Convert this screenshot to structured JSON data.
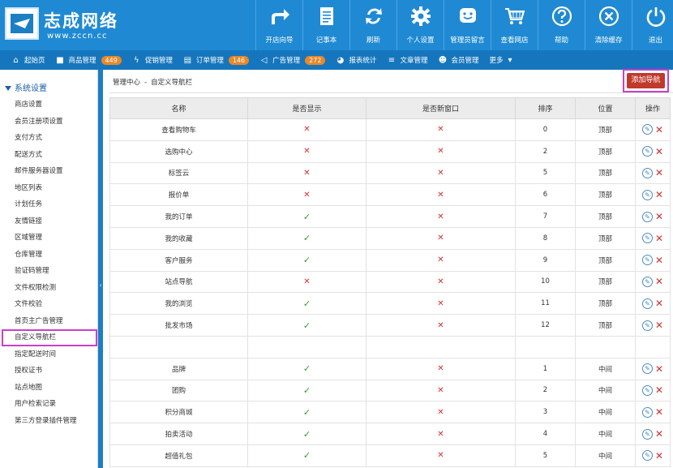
{
  "header": {
    "logo_title": "志成网络",
    "logo_url_text": "www.zccn.cc",
    "tools": [
      {
        "label": "开店向导",
        "icon": "arrow-share-icon"
      },
      {
        "label": "记事本",
        "icon": "notepad-icon"
      },
      {
        "label": "刷新",
        "icon": "refresh-icon"
      },
      {
        "label": "个人设置",
        "icon": "gear-icon"
      },
      {
        "label": "管理员留言",
        "icon": "message-face-icon"
      },
      {
        "label": "查看网店",
        "icon": "cart-icon"
      },
      {
        "label": "帮助",
        "icon": "help-icon"
      },
      {
        "label": "清除缓存",
        "icon": "close-circle-icon"
      },
      {
        "label": "退出",
        "icon": "power-icon"
      }
    ]
  },
  "nav": {
    "items": [
      {
        "label": "起始页",
        "icon": "home-icon"
      },
      {
        "label": "商品管理",
        "icon": "box-icon",
        "badge": "449"
      },
      {
        "label": "促销管理",
        "icon": "lightning-icon"
      },
      {
        "label": "订单管理",
        "icon": "clipboard-icon",
        "badge": "146"
      },
      {
        "label": "广告管理",
        "icon": "megaphone-icon",
        "badge": "272"
      },
      {
        "label": "报表统计",
        "icon": "pie-chart-icon"
      },
      {
        "label": "文章管理",
        "icon": "list-icon"
      },
      {
        "label": "会员管理",
        "icon": "users-icon"
      },
      {
        "label": "更多",
        "icon": "chevron-down-icon"
      }
    ]
  },
  "sidebar": {
    "section_title": "系统设置",
    "items": [
      "商店设置",
      "会员注册项设置",
      "支付方式",
      "配送方式",
      "邮件服务器设置",
      "地区列表",
      "计划任务",
      "友情链接",
      "区域管理",
      "仓库管理",
      "验证码管理",
      "文件权限检测",
      "文件校验",
      "首页主广告管理",
      "自定义导航栏",
      "指定配送时间",
      "授权证书",
      "站点地图",
      "用户检索记录",
      "第三方登录插件管理"
    ],
    "active_index": 14
  },
  "main": {
    "breadcrumb_root": "管理中心",
    "breadcrumb_sep": "-",
    "breadcrumb_current": "自定义导航栏",
    "add_button": "添加导航",
    "table": {
      "headers": [
        "名称",
        "是否显示",
        "是否新窗口",
        "排序",
        "位置",
        "操作"
      ],
      "rows": [
        {
          "name": "查看购物车",
          "show": false,
          "new_window": false,
          "order": "0",
          "position": "顶部"
        },
        {
          "name": "选购中心",
          "show": false,
          "new_window": false,
          "order": "2",
          "position": "顶部"
        },
        {
          "name": "标签云",
          "show": false,
          "new_window": false,
          "order": "5",
          "position": "顶部"
        },
        {
          "name": "报价单",
          "show": false,
          "new_window": false,
          "order": "6",
          "position": "顶部"
        },
        {
          "name": "我的订单",
          "show": true,
          "new_window": false,
          "order": "7",
          "position": "顶部"
        },
        {
          "name": "我的收藏",
          "show": true,
          "new_window": false,
          "order": "8",
          "position": "顶部"
        },
        {
          "name": "客户服务",
          "show": true,
          "new_window": false,
          "order": "9",
          "position": "顶部"
        },
        {
          "name": "站点导航",
          "show": false,
          "new_window": false,
          "order": "10",
          "position": "顶部"
        },
        {
          "name": "我的浏览",
          "show": true,
          "new_window": false,
          "order": "11",
          "position": "顶部"
        },
        {
          "name": "批发市场",
          "show": true,
          "new_window": false,
          "order": "12",
          "position": "顶部"
        },
        {
          "blank": true
        },
        {
          "name": "品牌",
          "show": true,
          "new_window": false,
          "order": "1",
          "position": "中间"
        },
        {
          "name": "团购",
          "show": true,
          "new_window": false,
          "order": "2",
          "position": "中间"
        },
        {
          "name": "积分商城",
          "show": true,
          "new_window": false,
          "order": "3",
          "position": "中间"
        },
        {
          "name": "拍卖活动",
          "show": true,
          "new_window": false,
          "order": "4",
          "position": "中间"
        },
        {
          "name": "超值礼包",
          "show": true,
          "new_window": false,
          "order": "5",
          "position": "中间"
        }
      ]
    }
  },
  "colors": {
    "header_bg": "#1f8ad3",
    "nav_bg": "#1676bd",
    "badge": "#e8882a",
    "add_button": "#c0392b",
    "highlight": "#c93fc8"
  }
}
